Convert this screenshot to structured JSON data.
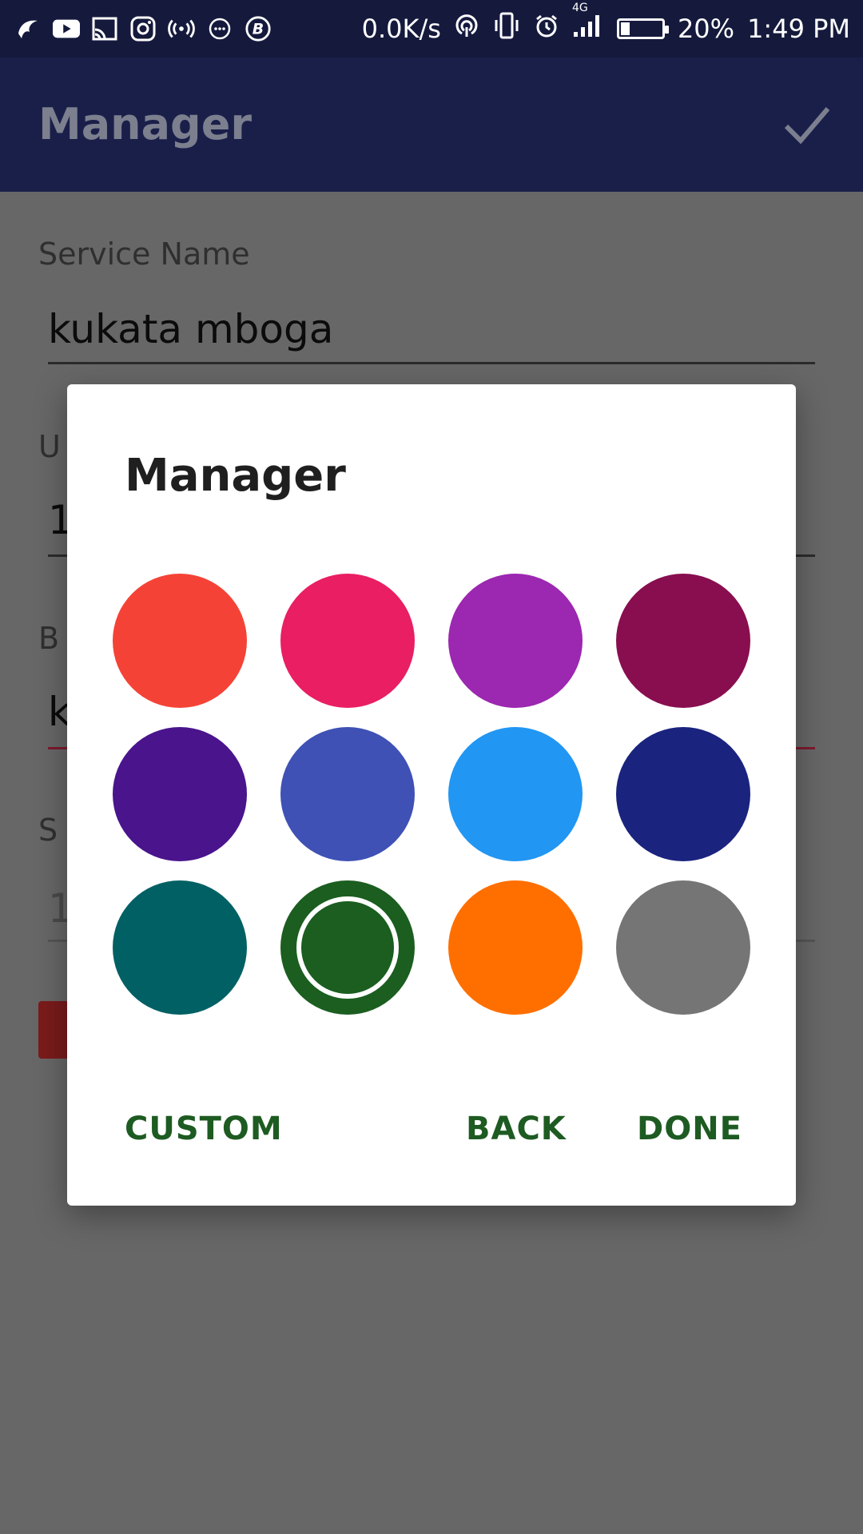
{
  "status_bar": {
    "network_speed": "0.0K/s",
    "network_type": "4G",
    "battery": "20%",
    "time": "1:49 PM",
    "left_icons": [
      "app-icon",
      "youtube-icon",
      "cast-icon",
      "instagram-icon",
      "hotspot-icon",
      "message-icon",
      "b-icon"
    ]
  },
  "app_bar": {
    "title": "Manager"
  },
  "form": {
    "service_name_label": "Service Name",
    "service_name_value": "kukata mboga",
    "field2_label_partial": "U",
    "field2_value_partial": "1",
    "field3_label_partial": "B",
    "field3_value_partial": "k",
    "field4_label_partial": "S",
    "field4_value_partial": "1"
  },
  "dialog": {
    "title": "Manager",
    "colors": [
      {
        "name": "red",
        "hex": "#f44336",
        "selected": false
      },
      {
        "name": "pink",
        "hex": "#e91e63",
        "selected": false
      },
      {
        "name": "purple",
        "hex": "#9c27b0",
        "selected": false
      },
      {
        "name": "maroon",
        "hex": "#880e4f",
        "selected": false
      },
      {
        "name": "deep-purple",
        "hex": "#4a148c",
        "selected": false
      },
      {
        "name": "indigo",
        "hex": "#3f51b5",
        "selected": false
      },
      {
        "name": "blue",
        "hex": "#2196f3",
        "selected": false
      },
      {
        "name": "dark-indigo",
        "hex": "#1a237e",
        "selected": false
      },
      {
        "name": "teal",
        "hex": "#006064",
        "selected": false
      },
      {
        "name": "green",
        "hex": "#1b5e20",
        "selected": true
      },
      {
        "name": "orange",
        "hex": "#ff6f00",
        "selected": false
      },
      {
        "name": "grey",
        "hex": "#757575",
        "selected": false
      }
    ],
    "buttons": {
      "custom": "CUSTOM",
      "back": "BACK",
      "done": "DONE"
    }
  }
}
